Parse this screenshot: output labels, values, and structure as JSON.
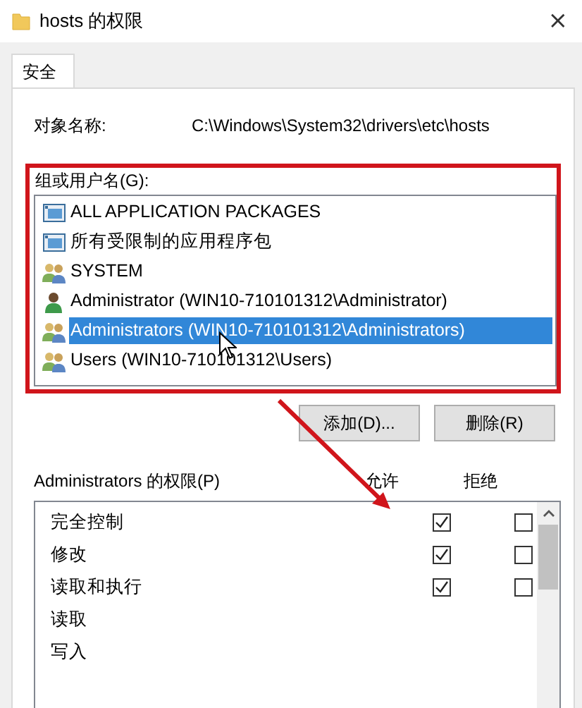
{
  "window": {
    "title": "hosts 的权限",
    "close": "×"
  },
  "tabs": [
    {
      "label": "安全",
      "selected": true
    }
  ],
  "object_name": {
    "label": "对象名称:",
    "value": "C:\\Windows\\System32\\drivers\\etc\\hosts"
  },
  "groups": {
    "label": "组或用户名(G):",
    "items": [
      {
        "name": "ALL APPLICATION PACKAGES",
        "kind": "package",
        "selected": false
      },
      {
        "name": "所有受限制的应用程序包",
        "kind": "package",
        "selected": false
      },
      {
        "name": "SYSTEM",
        "kind": "group",
        "selected": false
      },
      {
        "name": "Administrator (WIN10-710101312\\Administrator)",
        "kind": "user",
        "selected": false
      },
      {
        "name": "Administrators (WIN10-710101312\\Administrators)",
        "kind": "group",
        "selected": true
      },
      {
        "name": "Users (WIN10-710101312\\Users)",
        "kind": "group",
        "selected": false
      }
    ]
  },
  "buttons": [
    "添加(D)...",
    "删除(R)"
  ],
  "permissions": {
    "label": "Administrators 的权限(P)",
    "columns": [
      "允许",
      "拒绝"
    ],
    "rows": [
      {
        "name": "完全控制",
        "allow": true,
        "deny": false
      },
      {
        "name": "修改",
        "allow": true,
        "deny": false
      },
      {
        "name": "读取和执行",
        "allow": true,
        "deny": false
      },
      {
        "name": "读取"
      },
      {
        "name": "写入"
      }
    ]
  },
  "annotations": {
    "highlight_box": true,
    "arrow": true
  }
}
